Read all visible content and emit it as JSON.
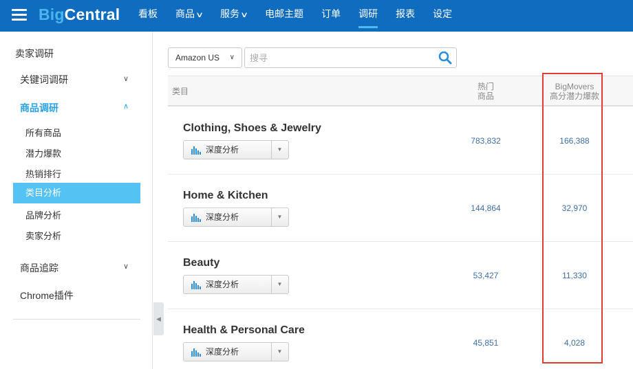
{
  "header": {
    "logo_big": "Big",
    "logo_central": "Central",
    "nav": [
      {
        "label": "看板",
        "dropdown": false,
        "active": false
      },
      {
        "label": "商品",
        "dropdown": true,
        "active": false
      },
      {
        "label": "服务",
        "dropdown": true,
        "active": false
      },
      {
        "label": "电邮主题",
        "dropdown": false,
        "active": false
      },
      {
        "label": "订单",
        "dropdown": false,
        "active": false
      },
      {
        "label": "调研",
        "dropdown": false,
        "active": true
      },
      {
        "label": "报表",
        "dropdown": false,
        "active": false
      },
      {
        "label": "设定",
        "dropdown": false,
        "active": false
      }
    ]
  },
  "sidebar": {
    "heading": "卖家调研",
    "keyword_research": "关键词调研",
    "product_research": "商品调研",
    "subitems": [
      "所有商品",
      "潜力爆款",
      "热销排行",
      "类目分析",
      "品牌分析",
      "卖家分析"
    ],
    "product_tracking": "商品追踪",
    "chrome_plugin": "Chrome插件"
  },
  "toolbar": {
    "market": "Amazon US",
    "search_placeholder": "搜寻"
  },
  "table": {
    "header": {
      "category": "类目",
      "hot_line1": "热门",
      "hot_line2": "商品",
      "big_line1": "BigMovers",
      "big_line2": "高分潜力爆款"
    },
    "analysis_button": "深度分析",
    "rows": [
      {
        "name": "Clothing, Shoes & Jewelry",
        "hot": "783,832",
        "big": "166,388"
      },
      {
        "name": "Home & Kitchen",
        "hot": "144,864",
        "big": "32,970"
      },
      {
        "name": "Beauty",
        "hot": "53,427",
        "big": "11,330"
      },
      {
        "name": "Health & Personal Care",
        "hot": "45,851",
        "big": "4,028"
      }
    ]
  },
  "colors": {
    "topbar": "#0f6cbf",
    "accent": "#28a2e4",
    "active_item": "#54c3f4",
    "highlight": "#e53935",
    "number": "#3d6ea5"
  },
  "icons": [
    "hamburger-menu-icon",
    "chevron-down-icon",
    "chevron-up-icon",
    "search-icon",
    "bar-chart-icon",
    "caret-down-icon",
    "collapse-left-icon"
  ]
}
